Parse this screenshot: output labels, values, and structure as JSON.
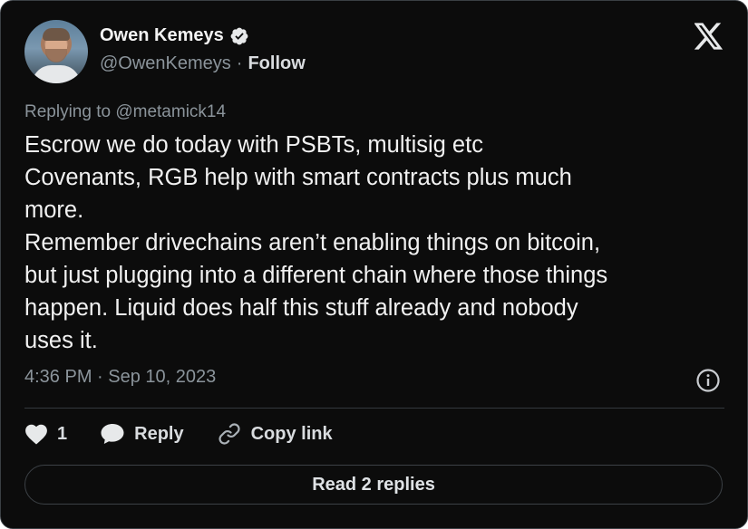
{
  "author": {
    "name": "Owen Kemeys",
    "handle": "@OwenKemeys",
    "separator": "·",
    "follow_label": "Follow",
    "verified": true
  },
  "brand_icon": "x-logo-icon",
  "reply_context": "Replying to @metamick14",
  "tweet_text": "Escrow we do today with PSBTs, multisig etc\nCovenants, RGB help with smart contracts plus much\nmore.\nRemember drivechains aren’t enabling things on bitcoin,\nbut just plugging into a different chain where those things\nhappen. Liquid does half this stuff already and nobody\nuses it.",
  "timestamp": "4:36 PM · Sep 10, 2023",
  "actions": {
    "like_count": "1",
    "reply_label": "Reply",
    "copy_label": "Copy link"
  },
  "read_replies_label": "Read 2 replies",
  "colors": {
    "background": "#0c0c0c",
    "text": "#e7e9ea",
    "muted": "#8b949b",
    "border": "#3a3f44"
  }
}
